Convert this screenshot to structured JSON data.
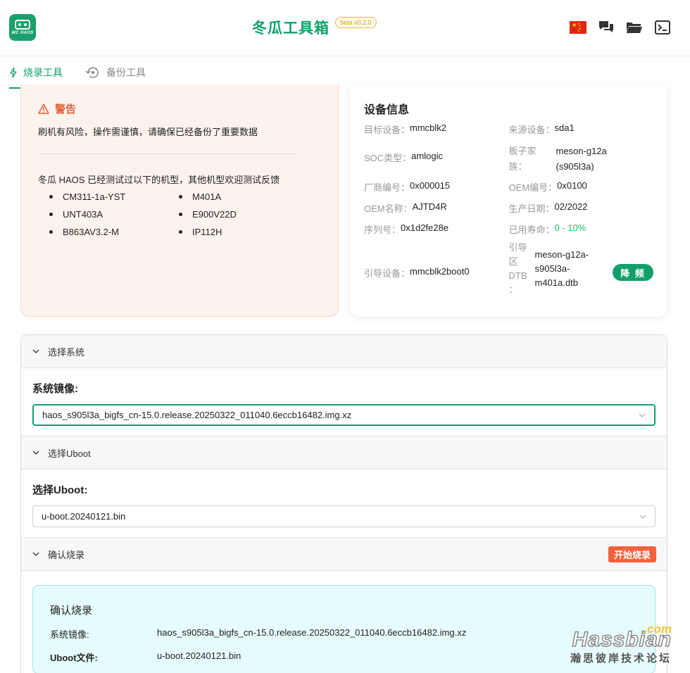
{
  "header": {
    "logo_text": "WC HAOS",
    "title": "冬瓜工具箱",
    "version": "beta v0.2.0",
    "icons": [
      "china-flag-icon",
      "chat-icon",
      "folder-icon",
      "terminal-icon"
    ]
  },
  "tabs": [
    {
      "label": "烧录工具",
      "icon": "lightning-icon",
      "active": true
    },
    {
      "label": "备份工具",
      "icon": "backup-icon",
      "active": false
    }
  ],
  "warning": {
    "title": "警告",
    "text": "刷机有风险，操作需谨慎，请确保已经备份了重要数据",
    "tested_text": "冬瓜 HAOS 已经测试过以下的机型，其他机型欢迎测试反馈",
    "models": [
      "CM311-1a-YST",
      "M401A",
      "UNT403A",
      "E900V22D",
      "B863AV3.2-M",
      "IP112H"
    ]
  },
  "device": {
    "title": "设备信息",
    "target_label": "目标设备：",
    "target_value": "mmcblk2",
    "source_label": "来源设备：",
    "source_value": "sda1",
    "soc_label": "SOC类型：",
    "soc_value": "amlogic",
    "board_label_1": "板子家",
    "board_label_2": "族：",
    "board_value_1": "meson-g12a",
    "board_value_2": "(s905l3a)",
    "vendor_label": "厂商编号：",
    "vendor_value": "0x000015",
    "oem_id_label": "OEM编号：",
    "oem_id_value": "0x0100",
    "oem_name_label": "OEM名称：",
    "oem_name_value": "AJTD4R",
    "date_label": "生产日期：",
    "date_value": "02/2022",
    "serial_label": "序列号：",
    "serial_value": "0x1d2fe28e",
    "life_label": "已用寿命：",
    "life_value": "0 - 10%",
    "boot_label": "引导设备：",
    "boot_value": "mmcblk2boot0",
    "dtb_label_1": "引导",
    "dtb_label_2": "区",
    "dtb_label_3": "DTB",
    "dtb_label_4": "：",
    "dtb_value_1": "meson-g12a-",
    "dtb_value_2": "s905l3a-",
    "dtb_value_3": "m401a.dtb",
    "speed_button": "降 频"
  },
  "sections": {
    "system": {
      "header": "选择系统",
      "label": "系统镜像:",
      "value": "haos_s905l3a_bigfs_cn-15.0.release.20250322_011040.6eccb16482.img.xz"
    },
    "uboot": {
      "header": "选择Uboot",
      "label": "选择Uboot:",
      "value": "u-boot.20240121.bin"
    },
    "confirm": {
      "header": "确认烧录",
      "start_button": "开始烧录",
      "box_title": "确认烧录",
      "image_label": "系统镜像:",
      "image_value": "haos_s905l3a_bigfs_cn-15.0.release.20250322_011040.6eccb16482.img.xz",
      "uboot_label": "Uboot文件:",
      "uboot_value": "u-boot.20240121.bin"
    }
  },
  "watermark": {
    "com": ".com",
    "main": "Hassbian",
    "sub": "瀚思彼岸技术论坛"
  }
}
